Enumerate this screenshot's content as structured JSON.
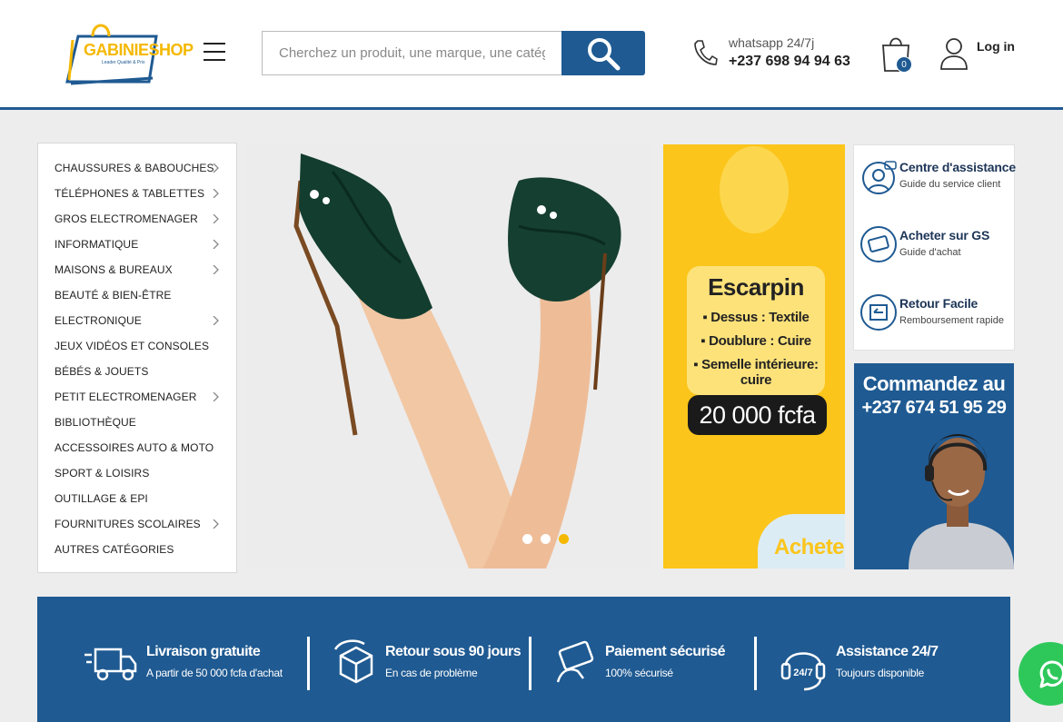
{
  "header": {
    "logo_text": "GABINIESHOP",
    "logo_tagline": "Leader Qualité & Prix",
    "search_placeholder": "Cherchez un produit, une marque, une catégorie",
    "contact_label": "whatsapp 24/7j",
    "contact_phone": "+237 698 94 94 63",
    "cart_count": "0",
    "login_label": "Log in"
  },
  "sidebar": {
    "categories": [
      {
        "label": "CHAUSSURES & BABOUCHES",
        "has_sub": true
      },
      {
        "label": "TÉLÉPHONES & TABLETTES",
        "has_sub": true
      },
      {
        "label": "GROS ELECTROMENAGER",
        "has_sub": true
      },
      {
        "label": "INFORMATIQUE",
        "has_sub": true
      },
      {
        "label": "MAISONS & BUREAUX",
        "has_sub": true
      },
      {
        "label": "BEAUTÉ & BIEN-ÊTRE",
        "has_sub": false
      },
      {
        "label": "ELECTRONIQUE",
        "has_sub": true
      },
      {
        "label": "JEUX VIDÉOS ET CONSOLES",
        "has_sub": false
      },
      {
        "label": "BÉBÉS & JOUETS",
        "has_sub": false
      },
      {
        "label": "PETIT ELECTROMENAGER",
        "has_sub": true
      },
      {
        "label": "BIBLIOTHÈQUE",
        "has_sub": false
      },
      {
        "label": "ACCESSOIRES AUTO & MOTO",
        "has_sub": false
      },
      {
        "label": "SPORT & LOISIRS",
        "has_sub": false
      },
      {
        "label": "OUTILLAGE & EPI",
        "has_sub": false
      },
      {
        "label": "FOURNITURES SCOLAIRES",
        "has_sub": true
      },
      {
        "label": "AUTRES CATÉGORIES",
        "has_sub": false
      }
    ]
  },
  "slider": {
    "active_index": 2
  },
  "promo": {
    "title": "Escarpin",
    "lines": [
      "▪ Dessus : Textile",
      "▪ Doublure : Cuire",
      "▪ Semelle intérieure: cuire"
    ],
    "price": "20 000 fcfa",
    "cta": "Acheter"
  },
  "services": [
    {
      "title": "Centre d'assistance",
      "subtitle": "Guide du service client",
      "icon": "headset-icon"
    },
    {
      "title": "Acheter sur GS",
      "subtitle": "Guide d'achat",
      "icon": "card-icon"
    },
    {
      "title": "Retour Facile",
      "subtitle": "Remboursement rapide",
      "icon": "return-icon"
    }
  ],
  "order": {
    "line1": "Commandez au",
    "line2": "+237 674 51 95 29"
  },
  "features": [
    {
      "title": "Livraison gratuite",
      "subtitle": "A partir de 50 000 fcfa d'achat",
      "icon": "truck-icon"
    },
    {
      "title": "Retour sous 90 jours",
      "subtitle": "En cas de problème",
      "icon": "box-return-icon"
    },
    {
      "title": "Paiement sécurisé",
      "subtitle": "100% sécurisé",
      "icon": "card-secure-icon"
    },
    {
      "title": "Assistance 24/7",
      "subtitle": "Toujours disponible",
      "icon": "support-247-icon",
      "badge": "24/7"
    }
  ],
  "colors": {
    "brand_blue": "#1f5a92",
    "brand_yellow": "#fbc51b",
    "whatsapp_green": "#2ec85a"
  }
}
